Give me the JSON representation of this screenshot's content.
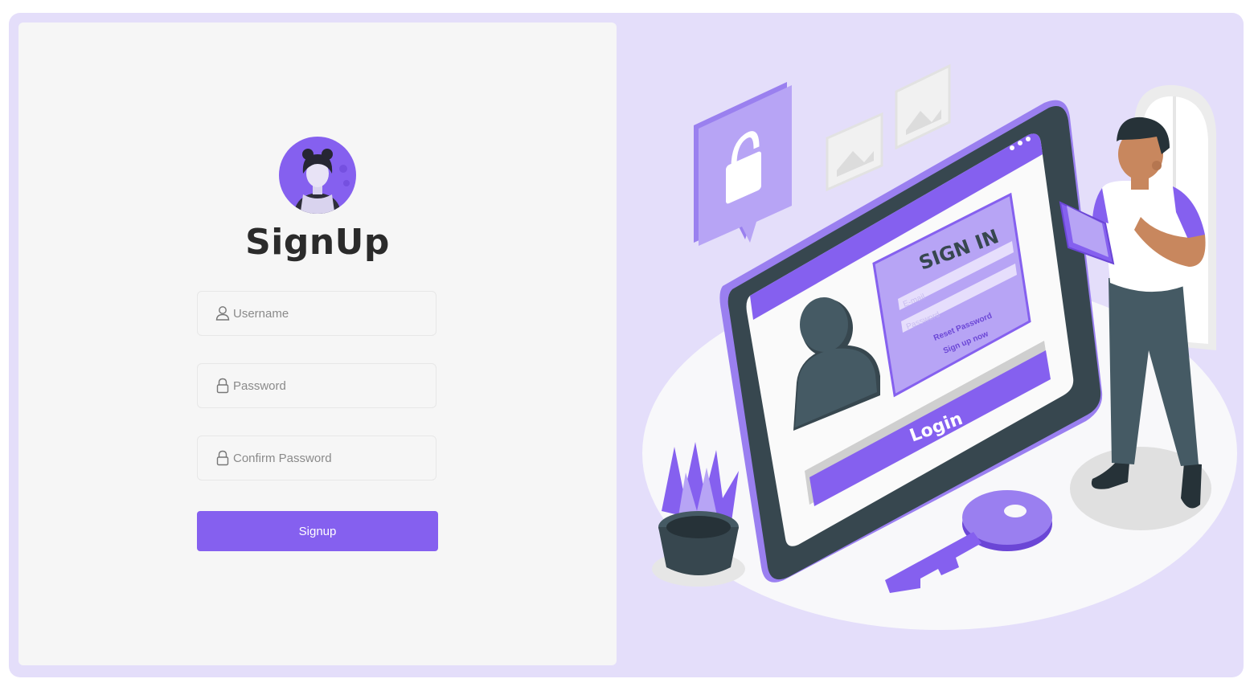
{
  "signup": {
    "title": "SignUp",
    "fields": [
      {
        "placeholder": "Username",
        "icon": "user-icon"
      },
      {
        "placeholder": "Password",
        "icon": "lock-icon"
      },
      {
        "placeholder": "Confirm Password",
        "icon": "lock-icon"
      }
    ],
    "button_label": "Signup"
  },
  "illustration": {
    "card_title": "SIGN IN",
    "email_placeholder": "E-mail",
    "password_placeholder": "Password",
    "reset_link": "Reset Password",
    "signup_link": "Sign up now",
    "login_label": "Login"
  },
  "colors": {
    "accent": "#8560ef",
    "frame_bg": "#e4defa",
    "panel_bg": "#f6f6f6"
  }
}
